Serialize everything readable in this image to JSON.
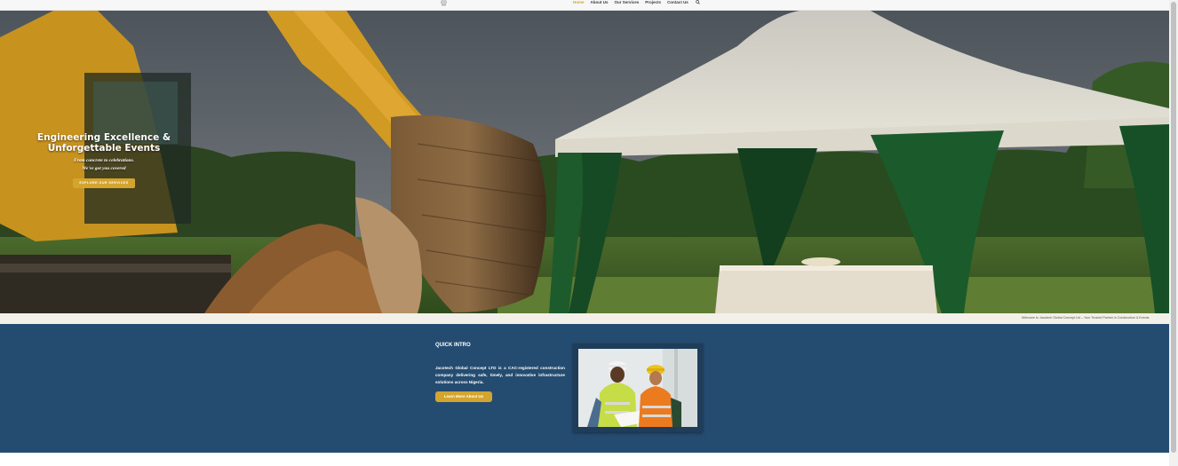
{
  "nav": {
    "items": [
      {
        "label": "Home",
        "active": true
      },
      {
        "label": "About Us",
        "active": false
      },
      {
        "label": "Our Services",
        "active": false
      },
      {
        "label": "Projects",
        "active": false
      },
      {
        "label": "Contact Us",
        "active": false
      }
    ],
    "search_icon": "search-icon",
    "active_color": "#d9a32c"
  },
  "hero": {
    "title_line1": "Engineering Excellence &",
    "title_line2": "Unforgettable Events",
    "subtitle_line1": "From concrete to celebrations.",
    "subtitle_line2": "We've got you covered",
    "cta_label": "EXPLORE OUR SERVICES"
  },
  "ticker": {
    "text": "Welcome to Jacotech Global Concept Ltd – Your Trusted Partner in Construction & Events"
  },
  "intro": {
    "heading": "QUICK INTRO",
    "body": "Jacotech Global Concept LTD is a CAC-registered construction company delivering safe, timely, and innovative infrastructure solutions across Nigeria.",
    "button_label": "Learn More About Us",
    "background_color": "#244b70",
    "accent_color": "#d4a52e"
  }
}
